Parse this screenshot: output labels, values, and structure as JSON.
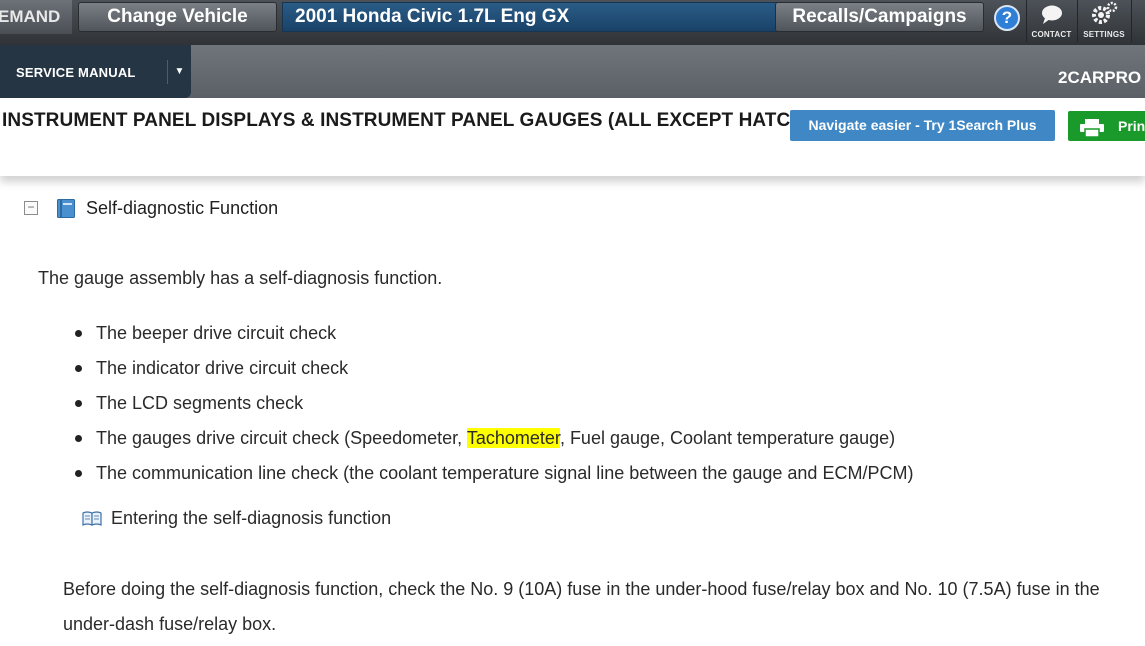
{
  "topbar": {
    "brand_fragment": "EMAND",
    "change_vehicle_label": "Change Vehicle",
    "vehicle": "2001 Honda Civic 1.7L Eng GX",
    "recalls_label": "Recalls/Campaigns",
    "help_label": "?",
    "contact_label": "CONTACT",
    "settings_label": "SETTINGS",
    "contact_icon": "chat-bubble-icon",
    "settings_icon": "gears-icon"
  },
  "subbar": {
    "service_manual_label": "SERVICE MANUAL",
    "brand_right": "2CARPRO"
  },
  "titlebar": {
    "title": "INSTRUMENT PANEL DISPLAYS & INSTRUMENT PANEL GAUGES (ALL EXCEPT HATCHE",
    "navigate_button": "Navigate easier - Try 1Search Plus",
    "print_label": "Prin"
  },
  "content": {
    "section_title": "Self-diagnostic Function",
    "intro": "The gauge assembly has a self-diagnosis function.",
    "bullets": {
      "b1": "The beeper drive circuit check",
      "b2": "The indicator drive circuit check",
      "b3": "The LCD segments check",
      "b4_before": "The gauges drive circuit check (Speedometer, ",
      "b4_highlight": "Tachometer",
      "b4_after": ", Fuel gauge, Coolant temperature gauge)",
      "b5": "The communication line check (the coolant temperature signal line between the gauge and ECM/PCM)"
    },
    "sub_link": "Entering the self-diagnosis function",
    "paragraph": "Before doing the self-diagnosis function, check the No. 9 (10A) fuse in the under-hood fuse/relay box and No. 10 (7.5A) fuse in the under-dash fuse/relay box."
  },
  "colors": {
    "vehicle_field": "#1f4e79",
    "service_manual_bg": "#253544",
    "navigate_button": "#3f88c5",
    "print_button": "#1a9a2a",
    "highlight": "#ffff00"
  }
}
